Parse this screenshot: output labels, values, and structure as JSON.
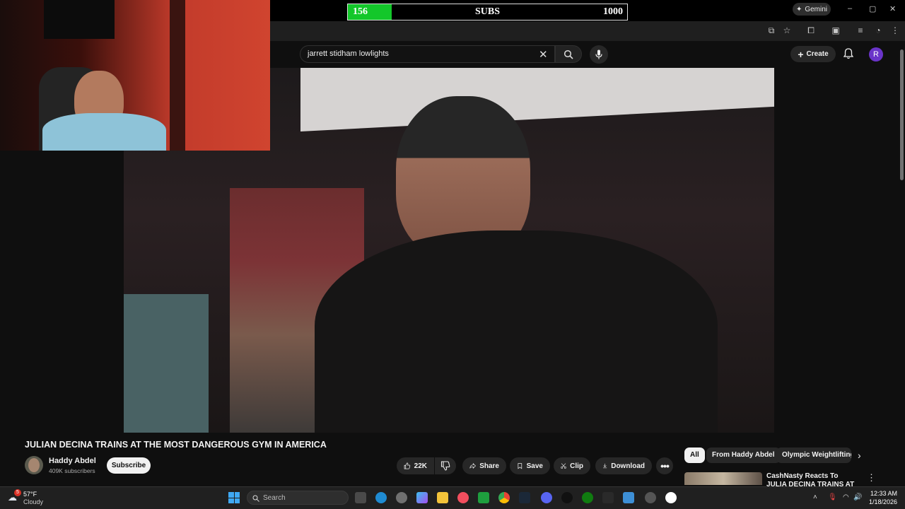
{
  "subs_goal": {
    "current": "156",
    "label": "SUBS",
    "goal": "1000",
    "progress": 0.156
  },
  "browser": {
    "gemini_label": "Gemini",
    "window_controls": [
      "–",
      "▢",
      "✕"
    ]
  },
  "youtube": {
    "search_query": "jarrett stidham lowlights",
    "create_label": "Create",
    "avatar_letter": "R"
  },
  "video": {
    "title": "JULIAN DECINA TRAINS AT THE MOST DANGEROUS GYM IN AMERICA",
    "channel_name": "Haddy Abdel",
    "channel_subscribers": "409K subscribers",
    "subscribe_label": "Subscribe",
    "likes": "22K",
    "share_label": "Share",
    "save_label": "Save",
    "clip_label": "Clip",
    "download_label": "Download"
  },
  "chips": [
    "All",
    "From Haddy Abdel",
    "Olympic Weightlifting"
  ],
  "recommendation": {
    "title": "CashNasty Reacts To JULIA DECINA TRAINS AT MOST"
  },
  "taskbar": {
    "weather_temp": "57°F",
    "weather_desc": "Cloudy",
    "weather_badge": "5",
    "search_label": "Search",
    "time": "12:33 AM",
    "date": "1/18/2026"
  },
  "colors": {
    "progress_green": "#13c72a",
    "avatar_purple": "#6a34c9",
    "youtube_bg": "#0f0f0f"
  }
}
